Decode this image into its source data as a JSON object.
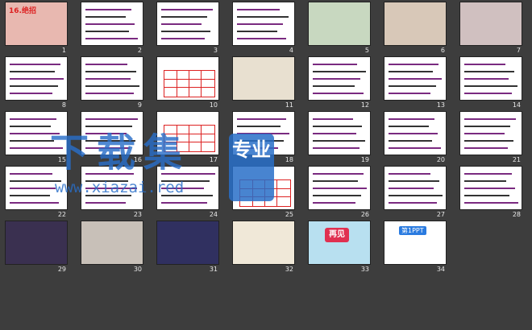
{
  "slides": [
    {
      "n": "1",
      "title": "16.绝招",
      "kind": "photo",
      "bg": "#e8b8b0"
    },
    {
      "n": "2",
      "kind": "text",
      "bg": "#ffffff"
    },
    {
      "n": "3",
      "kind": "text",
      "bg": "#ffffff"
    },
    {
      "n": "4",
      "kind": "text",
      "bg": "#ffffff"
    },
    {
      "n": "5",
      "kind": "photo",
      "bg": "#c8d8c0"
    },
    {
      "n": "6",
      "kind": "photo",
      "bg": "#d8c8b8"
    },
    {
      "n": "7",
      "kind": "photo",
      "bg": "#d0c0c0"
    },
    {
      "n": "8",
      "kind": "text",
      "bg": "#ffffff"
    },
    {
      "n": "9",
      "kind": "text",
      "bg": "#ffffff"
    },
    {
      "n": "10",
      "kind": "table",
      "bg": "#ffffff"
    },
    {
      "n": "11",
      "kind": "photo",
      "bg": "#e8e0d0"
    },
    {
      "n": "12",
      "kind": "text",
      "bg": "#ffffff"
    },
    {
      "n": "13",
      "kind": "text",
      "bg": "#ffffff"
    },
    {
      "n": "14",
      "kind": "text",
      "bg": "#ffffff"
    },
    {
      "n": "15",
      "kind": "text",
      "bg": "#ffffff"
    },
    {
      "n": "16",
      "kind": "text",
      "bg": "#ffffff"
    },
    {
      "n": "17",
      "kind": "table",
      "bg": "#ffffff"
    },
    {
      "n": "18",
      "kind": "text",
      "bg": "#ffffff"
    },
    {
      "n": "19",
      "kind": "text",
      "bg": "#ffffff"
    },
    {
      "n": "20",
      "kind": "text",
      "bg": "#ffffff"
    },
    {
      "n": "21",
      "kind": "text",
      "bg": "#ffffff"
    },
    {
      "n": "22",
      "kind": "text",
      "bg": "#ffffff"
    },
    {
      "n": "23",
      "kind": "text",
      "bg": "#ffffff"
    },
    {
      "n": "24",
      "kind": "text",
      "bg": "#ffffff"
    },
    {
      "n": "25",
      "kind": "table",
      "bg": "#ffffff"
    },
    {
      "n": "26",
      "kind": "text",
      "bg": "#ffffff"
    },
    {
      "n": "27",
      "kind": "text",
      "bg": "#ffffff"
    },
    {
      "n": "28",
      "kind": "text",
      "bg": "#ffffff"
    },
    {
      "n": "29",
      "kind": "photo",
      "bg": "#3a3050"
    },
    {
      "n": "30",
      "kind": "photo",
      "bg": "#c8c0b8"
    },
    {
      "n": "31",
      "kind": "photo",
      "bg": "#303060"
    },
    {
      "n": "32",
      "kind": "photo",
      "bg": "#f0e8d8"
    },
    {
      "n": "33",
      "kind": "zaijian",
      "bg": "#b8e0f0",
      "label": "再见"
    },
    {
      "n": "34",
      "kind": "logo",
      "bg": "#ffffff",
      "label": "第1PPT"
    }
  ],
  "watermark": {
    "main": "下载集",
    "url": "www.xiazai.red",
    "badge": "专业"
  }
}
